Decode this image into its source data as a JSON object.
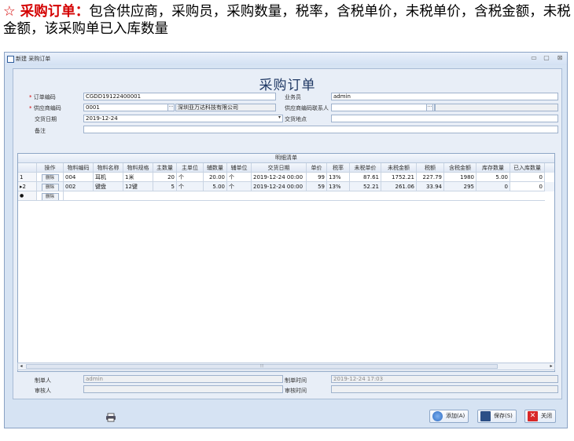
{
  "caption": {
    "star": "☆",
    "highlight": "采购订单：",
    "text": "包含供应商，采购员，采购数量，税率，含税单价，未税单价，含税金额，未税金额，该采购单已入库数量"
  },
  "window": {
    "title": "新建 采购订单",
    "form_title": "采购订单",
    "controls": {
      "min": "▭",
      "max": "▢",
      "close": "⊠"
    }
  },
  "form": {
    "order_code_label": "订单编码",
    "order_code": "CGDD19122400001",
    "supplier_code_label": "供应商编码",
    "supplier_code": "0001",
    "supplier_name": "深圳亚万达科技有限公司",
    "delivery_date_label": "交货日期",
    "delivery_date": "2019-12-24",
    "remark_label": "备注",
    "remark": "",
    "salesperson_label": "业务员",
    "salesperson": "admin",
    "supplier_contact_label": "供应商编码联系人",
    "supplier_contact": "",
    "delivery_place_label": "交货地点",
    "delivery_place": "",
    "ellipsis": "···",
    "dropdown": "▾"
  },
  "grid": {
    "caption": "明细清单",
    "columns": [
      "",
      "操作",
      "物料编码",
      "物料名称",
      "物料规格",
      "主数量",
      "主单位",
      "辅数量",
      "辅单位",
      "交货日期",
      "单价",
      "税率",
      "未税单价",
      "未税金额",
      "税额",
      "含税金额",
      "库存数量",
      "已入库数量"
    ],
    "delete_label": "删除",
    "rows": [
      {
        "indicator": "1",
        "code": "004",
        "name": "耳机",
        "spec": "1米",
        "qty": "20",
        "unit": "个",
        "aux_qty": "20.00",
        "aux_unit": "个",
        "date": "2019-12-24 00:00",
        "price": "99",
        "tax_rate": "13%",
        "net_price": "87.61",
        "net_amount": "1752.21",
        "tax": "227.79",
        "gross_amount": "1980",
        "stock": "5.00",
        "received": "0"
      },
      {
        "indicator": "▸2",
        "code": "002",
        "name": "键盘",
        "spec": "12键",
        "qty": "5",
        "unit": "个",
        "aux_qty": "5.00",
        "aux_unit": "个",
        "date": "2019-12-24 00:00",
        "price": "59",
        "tax_rate": "13%",
        "net_price": "52.21",
        "net_amount": "261.06",
        "tax": "33.94",
        "gross_amount": "295",
        "stock": "0",
        "received": "0"
      }
    ],
    "new_row_indicator": "●"
  },
  "bottom": {
    "creator_label": "制单人",
    "creator": "admin",
    "create_time_label": "制单时间",
    "create_time": "2019-12-24 17:03",
    "reviewer_label": "审核人",
    "reviewer": "",
    "review_time_label": "审核时间",
    "review_time": ""
  },
  "buttons": {
    "add": "添加(A)",
    "save": "保存(S)",
    "close": "关闭"
  },
  "colors": {
    "accent": "#d40000",
    "title": "#1f3864",
    "window_bg": "#d6e3f3"
  }
}
